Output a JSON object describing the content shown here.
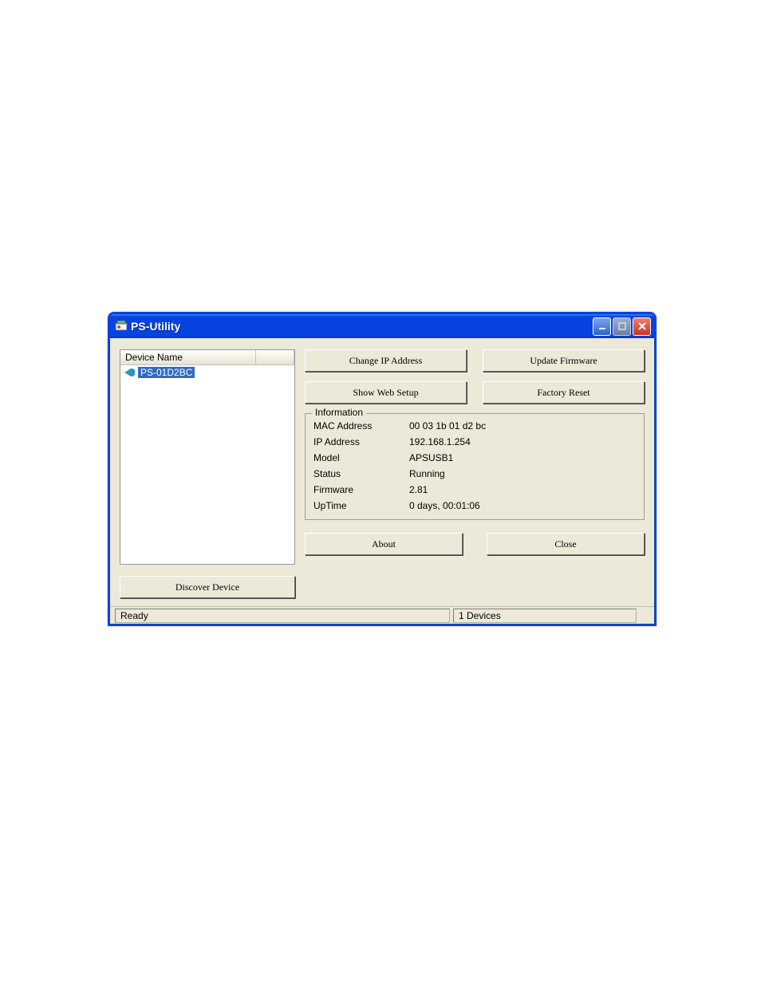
{
  "window": {
    "title": "PS-Utility"
  },
  "list": {
    "header": "Device Name",
    "items": [
      {
        "name": "PS-01D2BC"
      }
    ]
  },
  "buttons": {
    "discover": "Discover Device",
    "change_ip": "Change IP Address",
    "update_fw": "Update Firmware",
    "show_web": "Show Web Setup",
    "factory_reset": "Factory Reset",
    "about": "About",
    "close": "Close"
  },
  "info": {
    "legend": "Information",
    "rows": {
      "mac_label": "MAC Address",
      "mac_value": "00 03 1b 01 d2 bc",
      "ip_label": "IP Address",
      "ip_value": "192.168.1.254",
      "model_label": "Model",
      "model_value": "APSUSB1",
      "status_label": "Status",
      "status_value": "Running",
      "fw_label": "Firmware",
      "fw_value": "2.81",
      "uptime_label": "UpTime",
      "uptime_value": "0 days, 00:01:06"
    }
  },
  "statusbar": {
    "left": "Ready",
    "right": "1 Devices"
  }
}
